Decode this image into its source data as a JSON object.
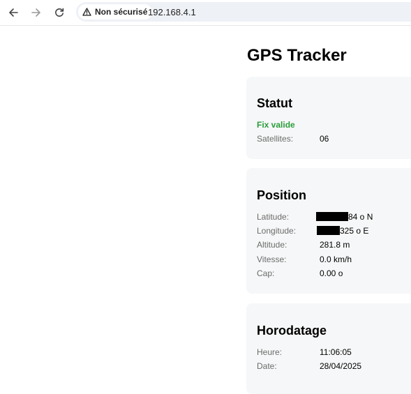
{
  "browser": {
    "security_label": "Non sécurisé",
    "url": "192.168.4.1",
    "icons": [
      "back-arrow-icon",
      "forward-arrow-icon",
      "reload-icon",
      "warning-triangle-icon"
    ]
  },
  "page": {
    "title": "GPS Tracker"
  },
  "status": {
    "heading": "Statut",
    "fix_text": "Fix valide",
    "fix_color": "#2a9d3a",
    "satellites_label": "Satellites:",
    "satellites_value": "06"
  },
  "position": {
    "heading": "Position",
    "latitude_label": "Latitude:",
    "latitude_value": "84 o N",
    "longitude_label": "Longitude:",
    "longitude_value": "325 o E",
    "altitude_label": "Altitude:",
    "altitude_value": "281.8 m",
    "speed_label": "Vitesse:",
    "speed_value": "0.0 km/h",
    "heading_label": "Cap:",
    "heading_value": "0.00 o"
  },
  "timestamp": {
    "heading": "Horodatage",
    "time_label": "Heure:",
    "time_value": "11:06:05",
    "date_label": "Date:",
    "date_value": "28/04/2025"
  }
}
